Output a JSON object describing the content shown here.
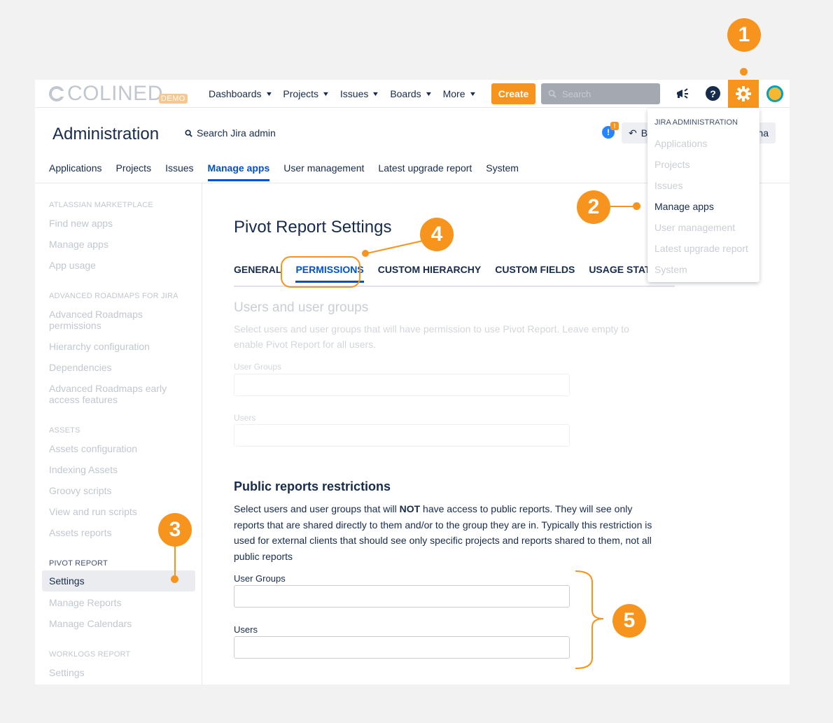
{
  "topbar": {
    "logo_text": "COLINED",
    "logo_badge": "DEMO",
    "nav": [
      "Dashboards",
      "Projects",
      "Issues",
      "Boards",
      "More"
    ],
    "create_label": "Create",
    "search_placeholder": "Search"
  },
  "header": {
    "title": "Administration",
    "search_label": "Search Jira admin",
    "notif_badge": "!",
    "back_prefix": "Ba",
    "back_tail": "na"
  },
  "admin_tabs": [
    "Applications",
    "Projects",
    "Issues",
    "Manage apps",
    "User management",
    "Latest upgrade report",
    "System"
  ],
  "sidebar": {
    "sections": [
      {
        "heading": "ATLASSIAN MARKETPLACE",
        "items": [
          "Find new apps",
          "Manage apps",
          "App usage"
        ]
      },
      {
        "heading": "ADVANCED ROADMAPS FOR JIRA",
        "items": [
          "Advanced Roadmaps permissions",
          "Hierarchy configuration",
          "Dependencies",
          "Advanced Roadmaps early access features"
        ]
      },
      {
        "heading": "ASSETS",
        "items": [
          "Assets configuration",
          "Indexing Assets",
          "Groovy scripts",
          "View and run scripts",
          "Assets reports"
        ]
      },
      {
        "heading": "PIVOT REPORT",
        "items": [
          "Settings",
          "Manage Reports",
          "Manage Calendars"
        ]
      },
      {
        "heading": "WORKLOGS REPORT",
        "items": [
          "Settings"
        ]
      }
    ]
  },
  "content": {
    "title": "Pivot Report Settings",
    "tabs": [
      "GENERAL",
      "PERMISSIONS",
      "CUSTOM HIERARCHY",
      "CUSTOM FIELDS",
      "USAGE STATISTIC"
    ],
    "users_section": {
      "title": "Users and user groups",
      "desc": "Select users and user groups that will have permission to use Pivot Report. Leave empty to enable Pivot Report for all users.",
      "groups_label": "User Groups",
      "users_label": "Users"
    },
    "public_section": {
      "title": "Public reports restrictions",
      "desc_before": "Select users and user groups that will ",
      "desc_bold": "NOT",
      "desc_after": " have access to public reports. They will see only reports that are shared directly to them and/or to the group they are in. Typically this restriction is used for external clients that should see only specific projects and reports shared to them, not all public reports",
      "groups_label": "User Groups",
      "users_label": "Users"
    }
  },
  "dropdown": {
    "heading": "JIRA ADMINISTRATION",
    "items": [
      "Applications",
      "Projects",
      "Issues",
      "Manage apps",
      "User management",
      "Latest upgrade report",
      "System"
    ]
  },
  "annotations": [
    "1",
    "2",
    "3",
    "4",
    "5"
  ],
  "colors": {
    "accent": "#f7941d",
    "link": "#0052cc",
    "text": "#172b4d"
  },
  "icons": [
    "megaphone-icon",
    "help-icon",
    "gear-icon",
    "search-icon",
    "chevron-down-icon",
    "info-icon",
    "back-arrow-icon"
  ]
}
